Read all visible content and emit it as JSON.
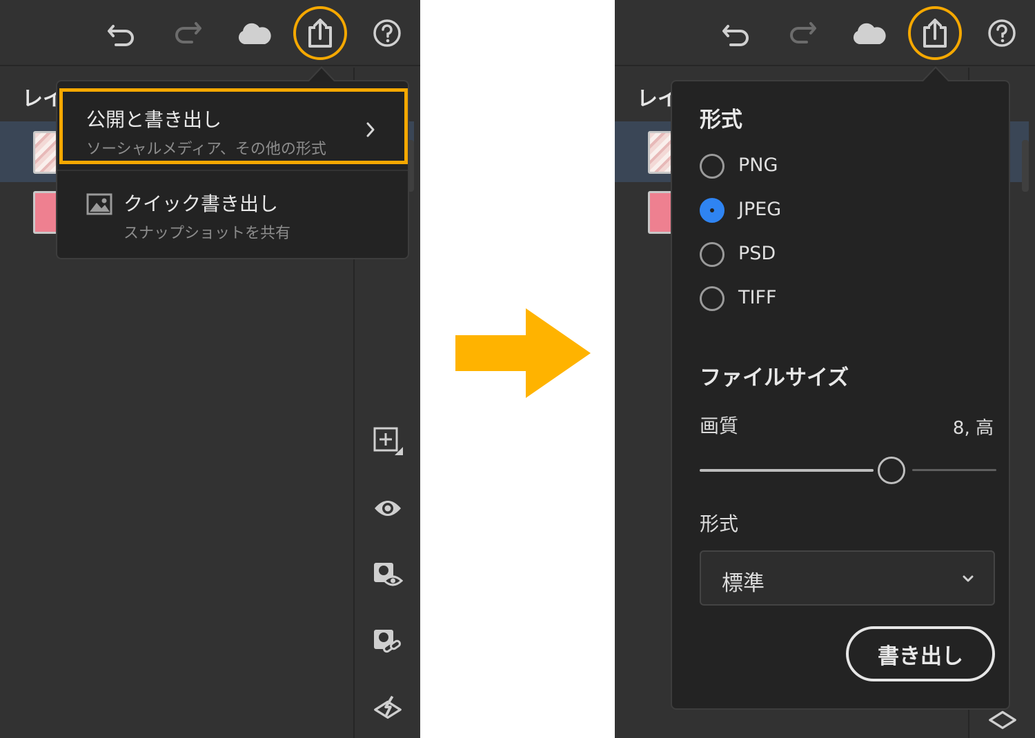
{
  "colors": {
    "highlight": "#f5a800",
    "arrow": "#ffb300",
    "radio_checked": "#2f84f2",
    "panel_bg": "#323232",
    "flyout_bg": "#232323"
  },
  "toolbar": {
    "icons": [
      "undo-icon",
      "redo-icon",
      "cloud-icon",
      "share-export-icon",
      "help-icon"
    ]
  },
  "layers": {
    "title": "レイヤー"
  },
  "left_menu": {
    "publish_export": {
      "title": "公開と書き出し",
      "subtitle": "ソーシャルメディア、その他の形式"
    },
    "quick_export": {
      "title": "クイック書き出し",
      "subtitle": "スナップショットを共有"
    }
  },
  "side_tools": [
    "add-layer-icon",
    "visibility-icon",
    "mask-visibility-icon",
    "mask-link-icon",
    "clear-layer-icon"
  ],
  "export_panel": {
    "format_title": "形式",
    "formats": [
      "PNG",
      "JPEG",
      "PSD",
      "TIFF"
    ],
    "selected_format": "JPEG",
    "filesize_title": "ファイルサイズ",
    "quality_label": "画質",
    "quality_value": "8, 高",
    "quality_fraction": 0.65,
    "type_label": "形式",
    "type_value": "標準",
    "export_button": "書き出し"
  }
}
